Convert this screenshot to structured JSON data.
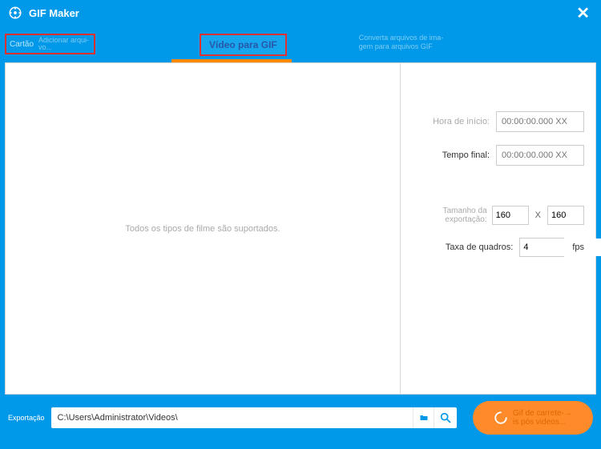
{
  "colors": {
    "primary": "#0098e8",
    "accent_highlight": "#e03030",
    "accent_button": "#ff8a2a",
    "underline": "#ff8a00"
  },
  "titlebar": {
    "title": "GIF Maker"
  },
  "tabs": {
    "first": {
      "label": "Cartão",
      "sub1": "Adicionar arqui-",
      "sub2": "vo..."
    },
    "middle": {
      "label": "Vídeo para GIF"
    },
    "right_desc_line1": "Converta arquivos de ima-",
    "right_desc_line2": "gem para arquivos GIF"
  },
  "left_pane": {
    "placeholder": "Todos os tipos de filme são suportados."
  },
  "form": {
    "start_label": "Hora de início:",
    "start_placeholder": "00:00:00.000 XX",
    "end_label": "Tempo final:",
    "end_placeholder": "00:00:00.000 XX",
    "size_label": "Tamanho da exportação:",
    "width_value": "160",
    "x_sep": "X",
    "height_value": "160",
    "fps_label": "Taxa de quadros:",
    "fps_value": "4",
    "fps_unit": "fps"
  },
  "footer": {
    "export_label": "Exportação",
    "path_value": "C:\\Users\\Administrator\\Videos\\",
    "button_line1": "Gif de carrete-→",
    "button_line2": "is pós videos..."
  }
}
